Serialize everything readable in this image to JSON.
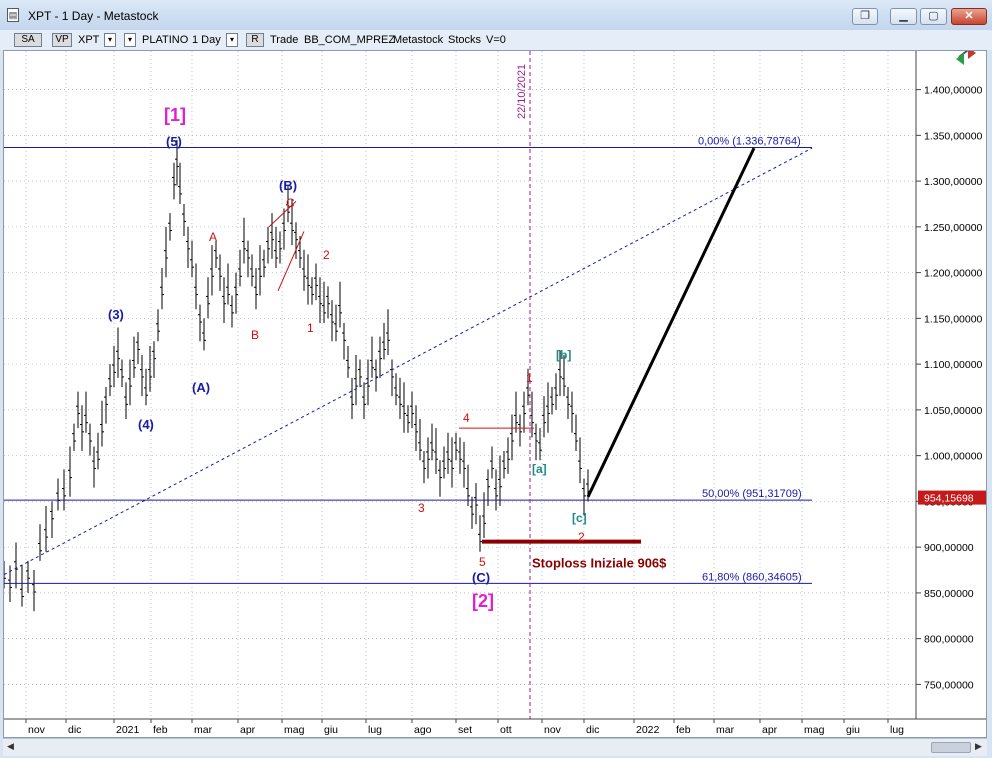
{
  "window": {
    "title": "XPT - 1 Day - Metastock",
    "buttons": {
      "restore": "❐",
      "minimize": "▁",
      "maximize": "▢",
      "close": "✕"
    }
  },
  "toolbar": {
    "sa_label": "SA",
    "vp_label": "VP",
    "symbol": "XPT",
    "name": "PLATINO",
    "period": "1 Day",
    "r_label": "R",
    "trade_label": "Trade",
    "template": "BB_COM_MPREZ",
    "source": "Metastock",
    "category": "Stocks",
    "volume": "V=0"
  },
  "chart_data": {
    "type": "candlestick",
    "x_tick_labels": [
      "nov",
      "dic",
      "2021",
      "feb",
      "mar",
      "apr",
      "mag",
      "giu",
      "lug",
      "ago",
      "set",
      "ott",
      "nov",
      "dic",
      "2022",
      "feb",
      "mar",
      "apr",
      "mag",
      "giu",
      "lug"
    ],
    "y_tick_labels": [
      "1.400,00000",
      "1.350,00000",
      "1.300,00000",
      "1.250,00000",
      "1.200,00000",
      "1.150,00000",
      "1.100,00000",
      "1.050,00000",
      "1.000,00000",
      "950,00000",
      "900,00000",
      "850,00000",
      "800,00000",
      "750,00000"
    ],
    "ylim": [
      710,
      1440
    ],
    "last_price_label": "954,15698",
    "vertical_marker_label": "22/10/2021",
    "fib_levels": [
      {
        "label": "0,00% (1.336,78764)",
        "value": 1336.78764
      },
      {
        "label": "50,00% (951,31709)",
        "value": 951.31709
      },
      {
        "label": "61,80% (860,34605)",
        "value": 860.34605
      }
    ],
    "stoploss_label": "Stoploss Iniziale 906$",
    "stoploss_value": 906,
    "wave_labels": {
      "major_1": "[1]",
      "major_2": "[2]",
      "w5": "(5)",
      "w3": "(3)",
      "w4": "(4)",
      "wA": "(A)",
      "wB": "(B)",
      "wC": "(C)",
      "a": "A",
      "b": "B",
      "c": "C",
      "s1": "1",
      "s2": "2",
      "s3": "3",
      "s4": "4",
      "s5": "5",
      "sa": "[a]",
      "sb": "[b]",
      "sc": "[c]",
      "r1": "1",
      "r2": "2"
    },
    "colors": {
      "magenta": "#e020d0",
      "navy": "#1a1aa8",
      "red": "#d01010",
      "teal": "#1c8a8a",
      "grid": "#8a9bb8",
      "candle": "#000000",
      "stoploss": "#8b0000",
      "price_tag": "#c41a1a"
    }
  }
}
